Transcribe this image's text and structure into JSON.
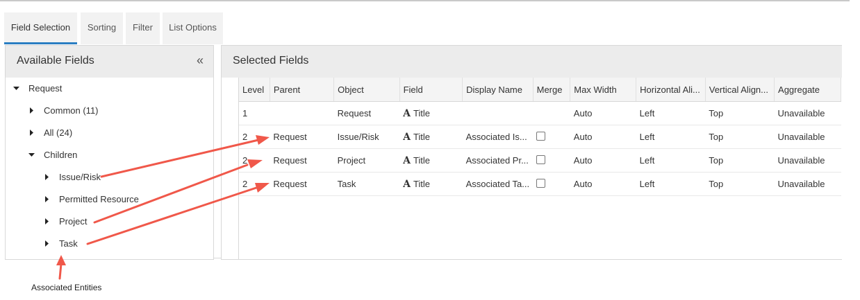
{
  "tabs": [
    "Field Selection",
    "Sorting",
    "Filter",
    "List Options"
  ],
  "left_panel": {
    "title": "Available Fields",
    "collapse_glyph": "«",
    "tree": [
      {
        "label": "Request",
        "expanded": true
      },
      {
        "label": "Common (11)",
        "expanded": false
      },
      {
        "label": "All (24)",
        "expanded": false
      },
      {
        "label": "Children",
        "expanded": true
      },
      {
        "label": "Issue/Risk",
        "expanded": false
      },
      {
        "label": "Permitted Resource",
        "expanded": false
      },
      {
        "label": "Project",
        "expanded": false
      },
      {
        "label": "Task",
        "expanded": false
      }
    ]
  },
  "right_panel": {
    "title": "Selected Fields",
    "columns": [
      "Level",
      "Parent",
      "Object",
      "Field",
      "Display Name",
      "Merge",
      "Max Width",
      "Horizontal Ali...",
      "Vertical Align...",
      "Aggregate"
    ],
    "rows": [
      {
        "level": "1",
        "parent": "",
        "object": "Request",
        "field": "Title",
        "display_name": "",
        "merge": null,
        "max_width": "Auto",
        "h_align": "Left",
        "v_align": "Top",
        "aggregate": "Unavailable"
      },
      {
        "level": "2",
        "parent": "Request",
        "object": "Issue/Risk",
        "field": "Title",
        "display_name": "Associated Is...",
        "merge": false,
        "max_width": "Auto",
        "h_align": "Left",
        "v_align": "Top",
        "aggregate": "Unavailable"
      },
      {
        "level": "2",
        "parent": "Request",
        "object": "Project",
        "field": "Title",
        "display_name": "Associated Pr...",
        "merge": false,
        "max_width": "Auto",
        "h_align": "Left",
        "v_align": "Top",
        "aggregate": "Unavailable"
      },
      {
        "level": "2",
        "parent": "Request",
        "object": "Task",
        "field": "Title",
        "display_name": "Associated Ta...",
        "merge": false,
        "max_width": "Auto",
        "h_align": "Left",
        "v_align": "Top",
        "aggregate": "Unavailable"
      }
    ]
  },
  "field_icon_glyph": "A",
  "icons": {
    "add": "arrow-right-icon",
    "collapse": "double-chevron-left-icon",
    "expand": "caret-down-icon",
    "collapsed": "caret-right-icon"
  },
  "annotation": {
    "caption": "Associated Entities",
    "color": "#f0584a"
  },
  "colors": {
    "active_tab_underline": "#2b7ec2",
    "header_bg": "#ececec"
  }
}
